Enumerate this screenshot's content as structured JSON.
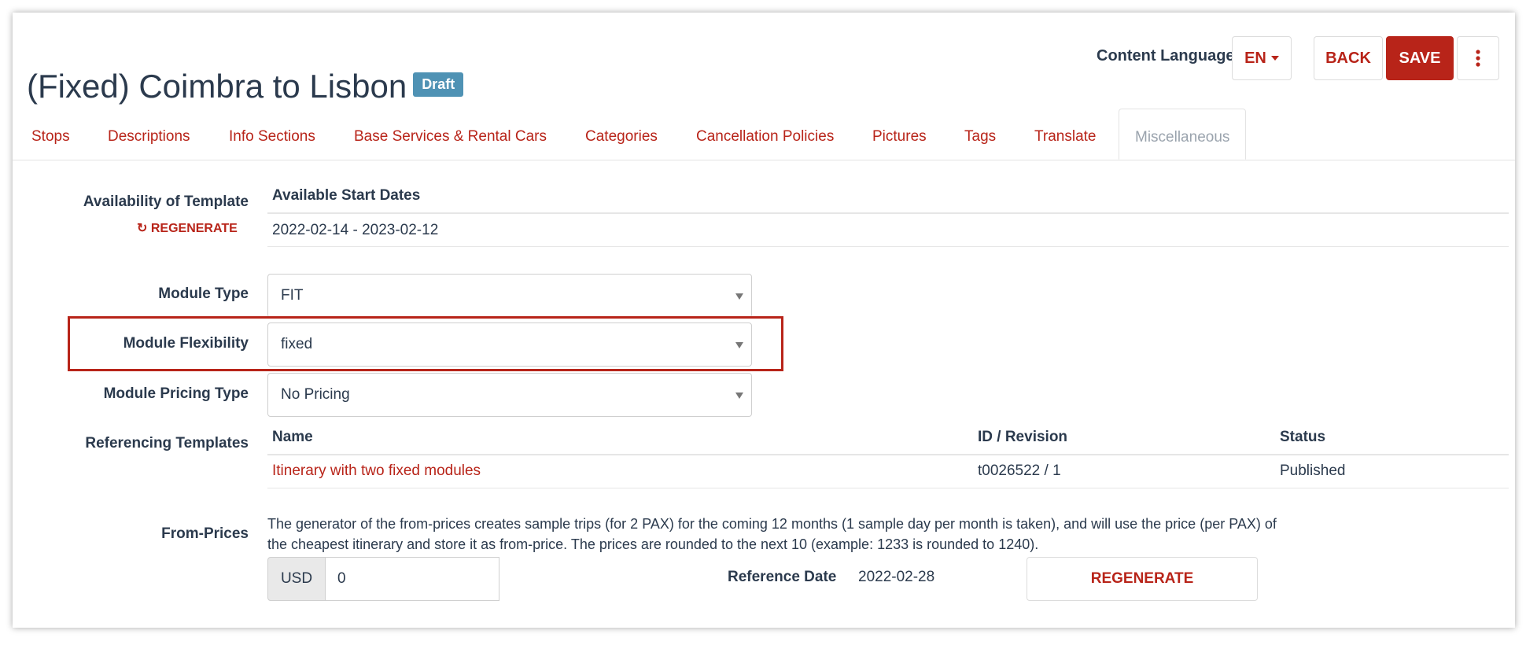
{
  "header": {
    "title": "(Fixed) Coimbra to Lisbon",
    "badge": "Draft",
    "content_language_label": "Content Language",
    "language_value": "EN",
    "back_label": "BACK",
    "save_label": "SAVE",
    "more_icon": "vertical-ellipsis-icon"
  },
  "tabs": [
    {
      "label": "Stops",
      "active": false
    },
    {
      "label": "Descriptions",
      "active": false
    },
    {
      "label": "Info Sections",
      "active": false
    },
    {
      "label": "Base Services & Rental Cars",
      "active": false
    },
    {
      "label": "Categories",
      "active": false
    },
    {
      "label": "Cancellation Policies",
      "active": false
    },
    {
      "label": "Pictures",
      "active": false
    },
    {
      "label": "Tags",
      "active": false
    },
    {
      "label": "Translate",
      "active": false
    },
    {
      "label": "Miscellaneous",
      "active": true
    }
  ],
  "availability": {
    "label": "Availability of Template",
    "regenerate_label": "REGENERATE",
    "column_header": "Available Start Dates",
    "value": "2022-02-14 - 2023-02-12"
  },
  "module_type": {
    "label": "Module Type",
    "value": "FIT"
  },
  "module_flexibility": {
    "label": "Module Flexibility",
    "value": "fixed"
  },
  "module_pricing_type": {
    "label": "Module Pricing Type",
    "value": "No Pricing"
  },
  "referencing_templates": {
    "label": "Referencing Templates",
    "columns": [
      "Name",
      "ID / Revision",
      "Status"
    ],
    "rows": [
      {
        "name": "Itinerary with two fixed modules",
        "id_revision": "t0026522 / 1",
        "status": "Published"
      }
    ]
  },
  "from_prices": {
    "label": "From-Prices",
    "description": "The generator of the from-prices creates sample trips (for 2 PAX) for the coming 12 months (1 sample day per month is taken), and will use the price (per PAX) of the cheapest itinerary and store it as from-price. The prices are rounded to the next 10 (example: 1233 is rounded to 1240).",
    "currency": "USD",
    "amount": "0",
    "reference_date_label": "Reference Date",
    "reference_date_value": "2022-02-28",
    "regenerate_label": "REGENERATE"
  },
  "colors": {
    "accent": "#b82419",
    "badge": "#4f92b4",
    "text": "#2b3a4d"
  }
}
